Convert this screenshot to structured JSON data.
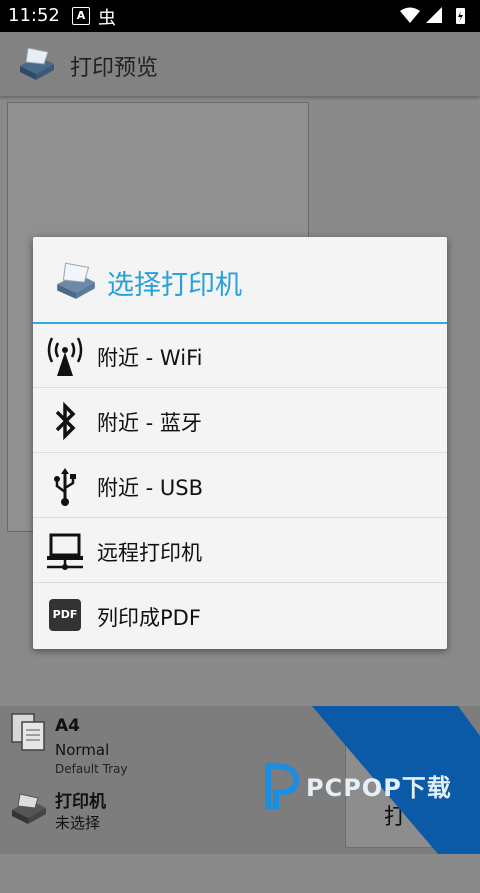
{
  "statusbar": {
    "time": "11:52",
    "notif_a": "A",
    "notif_bug": "虫"
  },
  "appbar": {
    "title": "打印预览"
  },
  "bottom": {
    "paper_size": "A4",
    "paper_mode": "Normal",
    "paper_tray": "Default Tray",
    "printer_label": "打印机",
    "printer_status": "未选择",
    "print_button": "打"
  },
  "dialog": {
    "title": "选择打印机",
    "items": [
      {
        "label": "附近 - WiFi",
        "icon": "wifi-antenna-icon"
      },
      {
        "label": "附近 - 蓝牙",
        "icon": "bluetooth-icon"
      },
      {
        "label": "附近 - USB",
        "icon": "usb-icon"
      },
      {
        "label": "远程打印机",
        "icon": "network-computer-icon"
      },
      {
        "label": "列印成PDF",
        "icon": "pdf-icon"
      }
    ],
    "pdf_badge": "PDF"
  },
  "watermark": {
    "text": "PCPOP下载"
  },
  "colors": {
    "accent": "#29a0db",
    "watermark": "#0a5aa8"
  }
}
